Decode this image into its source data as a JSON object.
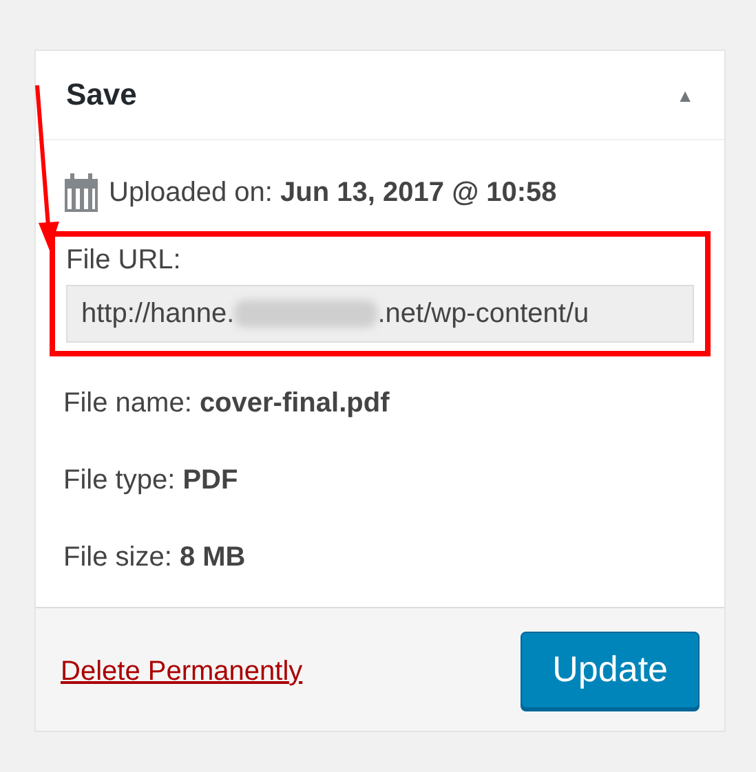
{
  "box": {
    "title": "Save",
    "collapse_glyph": "▲",
    "expanded": true
  },
  "uploaded": {
    "label": "Uploaded on:",
    "value": "Jun 13, 2017 @ 10:58"
  },
  "file_url": {
    "label": "File URL:",
    "url_start": "http://hanne.",
    "url_end": ".net/wp-content/u",
    "redacted": true,
    "highlighted": true
  },
  "details": [
    {
      "label": "File name:",
      "value": "cover-final.pdf"
    },
    {
      "label": "File type:",
      "value": "PDF"
    },
    {
      "label": "File size:",
      "value": "8 MB"
    }
  ],
  "actions": {
    "delete_link": "Delete Permanently",
    "update_button": "Update"
  },
  "annotation_arrow": true
}
